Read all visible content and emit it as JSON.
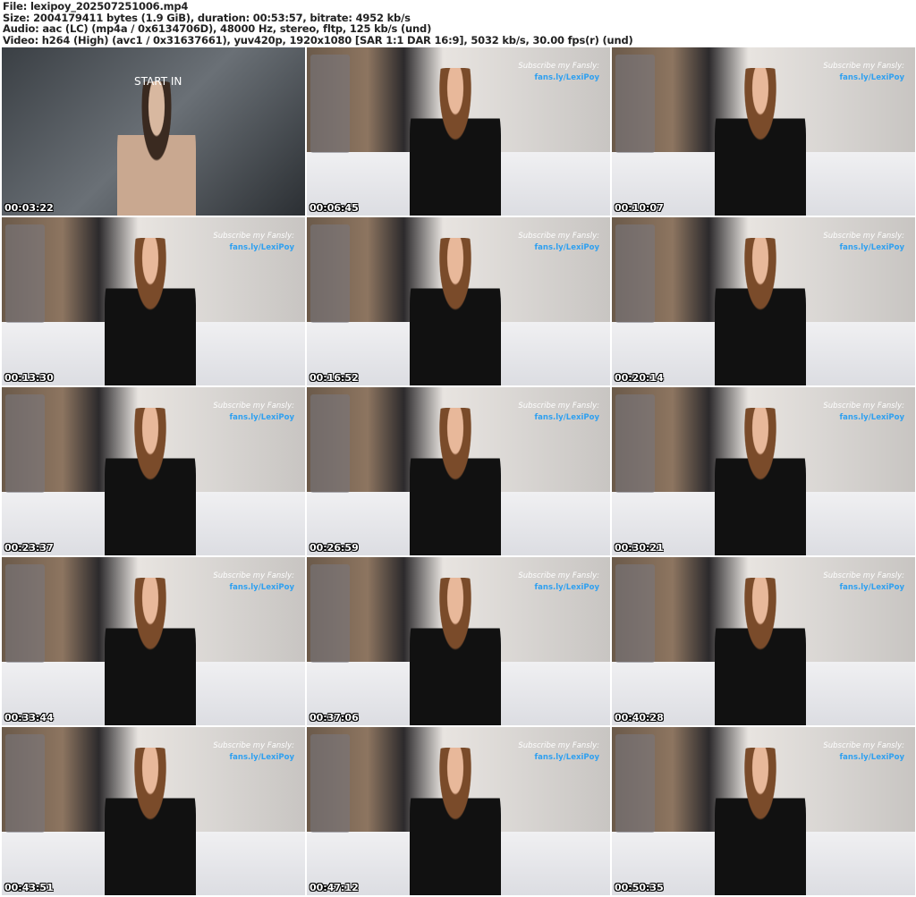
{
  "header": {
    "file": "File: lexipoy_202507251006.mp4",
    "size": "Size: 2004179411 bytes (1.9 GiB), duration: 00:53:57, bitrate: 4952 kb/s",
    "audio": "Audio: aac (LC) (mp4a / 0x6134706D), 48000 Hz, stereo, fltp, 125 kb/s (und)",
    "video": "Video: h264 (High) (avc1 / 0x31637661), yuv420p, 1920x1080 [SAR 1:1 DAR 16:9], 5032 kb/s, 30.00 fps(r) (und)"
  },
  "overlay": {
    "start_text": "START IN",
    "subscribe": "Subscribe my Fansly:",
    "link": "fans.ly/LexiPoy"
  },
  "thumbnails": [
    {
      "time": "00:03:22"
    },
    {
      "time": "00:06:45"
    },
    {
      "time": "00:10:07"
    },
    {
      "time": "00:13:30"
    },
    {
      "time": "00:16:52"
    },
    {
      "time": "00:20:14"
    },
    {
      "time": "00:23:37"
    },
    {
      "time": "00:26:59"
    },
    {
      "time": "00:30:21"
    },
    {
      "time": "00:33:44"
    },
    {
      "time": "00:37:06"
    },
    {
      "time": "00:40:28"
    },
    {
      "time": "00:43:51"
    },
    {
      "time": "00:47:12"
    },
    {
      "time": "00:50:35"
    }
  ]
}
